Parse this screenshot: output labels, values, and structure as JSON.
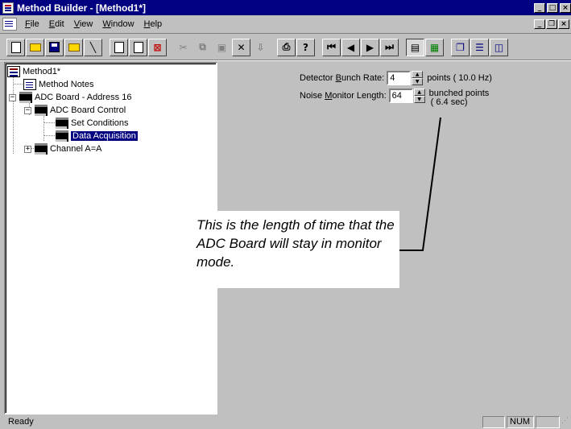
{
  "window": {
    "title": "Method Builder - [Method1*]"
  },
  "menu": {
    "items": [
      {
        "label_u": "F",
        "label_rest": "ile"
      },
      {
        "label_u": "E",
        "label_rest": "dit"
      },
      {
        "label_u": "V",
        "label_rest": "iew"
      },
      {
        "label_u": "W",
        "label_rest": "indow"
      },
      {
        "label_u": "H",
        "label_rest": "elp"
      }
    ]
  },
  "toolbar": {
    "buttons": [
      "new-method-icon",
      "open-icon",
      "save-icon",
      "open-folder-icon",
      "wand-icon",
      "properties-icon",
      "add-board-icon",
      "delete-board-icon",
      "cut-icon",
      "copy-icon",
      "paste-icon",
      "delete-icon",
      "import-icon",
      "print-icon",
      "help-icon",
      "first-icon",
      "previous-icon",
      "next-icon",
      "last-icon",
      "view-tree-icon",
      "view-grid-icon",
      "cascade-icon",
      "tile-horizontal-icon",
      "tile-vertical-icon"
    ]
  },
  "tree": {
    "root": "Method1*",
    "notes": "Method Notes",
    "board": "ADC Board - Address 16",
    "board_control": "ADC Board Control",
    "set_conditions": "Set Conditions",
    "data_acquisition": "Data Acquisition",
    "channel": "Channel A=A"
  },
  "form": {
    "bunch_rate": {
      "label_pre": "Detector ",
      "label_u": "B",
      "label_post": "unch Rate:",
      "value": "4",
      "units": "points ( 10.0 Hz)"
    },
    "noise_length": {
      "label_pre": "Noise ",
      "label_u": "M",
      "label_post": "onitor Length:",
      "value": "64",
      "units_line1": "bunched points",
      "units_line2": "( 6.4 sec)"
    }
  },
  "callout": {
    "text": "This is the length of time that the ADC Board will stay in monitor mode."
  },
  "status": {
    "message": "Ready",
    "num": "NUM"
  },
  "colors": {
    "titlebar": "#000080",
    "selection": "#000080",
    "face": "#c0c0c0"
  }
}
